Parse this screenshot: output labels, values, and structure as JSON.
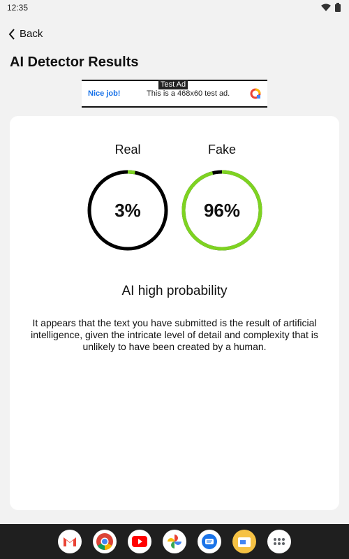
{
  "status": {
    "time": "12:35"
  },
  "header": {
    "back_label": "Back",
    "title": "AI Detector Results"
  },
  "ad": {
    "tag": "Test Ad",
    "left_text": "Nice job!",
    "right_text": "This is a 468x60 test ad."
  },
  "results": {
    "real": {
      "label": "Real",
      "value": "3%",
      "fraction": 0.03,
      "track_color": "#000000",
      "fill_color": "#7ed321"
    },
    "fake": {
      "label": "Fake",
      "value": "96%",
      "fraction": 0.96,
      "track_color": "#000000",
      "fill_color": "#7ed321"
    },
    "verdict": "AI high probability",
    "explanation": "It appears that the text you have submitted is the result of artificial intelligence, given the intricate level of detail and complexity that is unlikely to have been created by a human."
  },
  "dock": {
    "apps": [
      "gmail-icon",
      "chrome-icon",
      "youtube-icon",
      "photos-icon",
      "messages-icon",
      "files-icon",
      "app-drawer-icon"
    ]
  }
}
